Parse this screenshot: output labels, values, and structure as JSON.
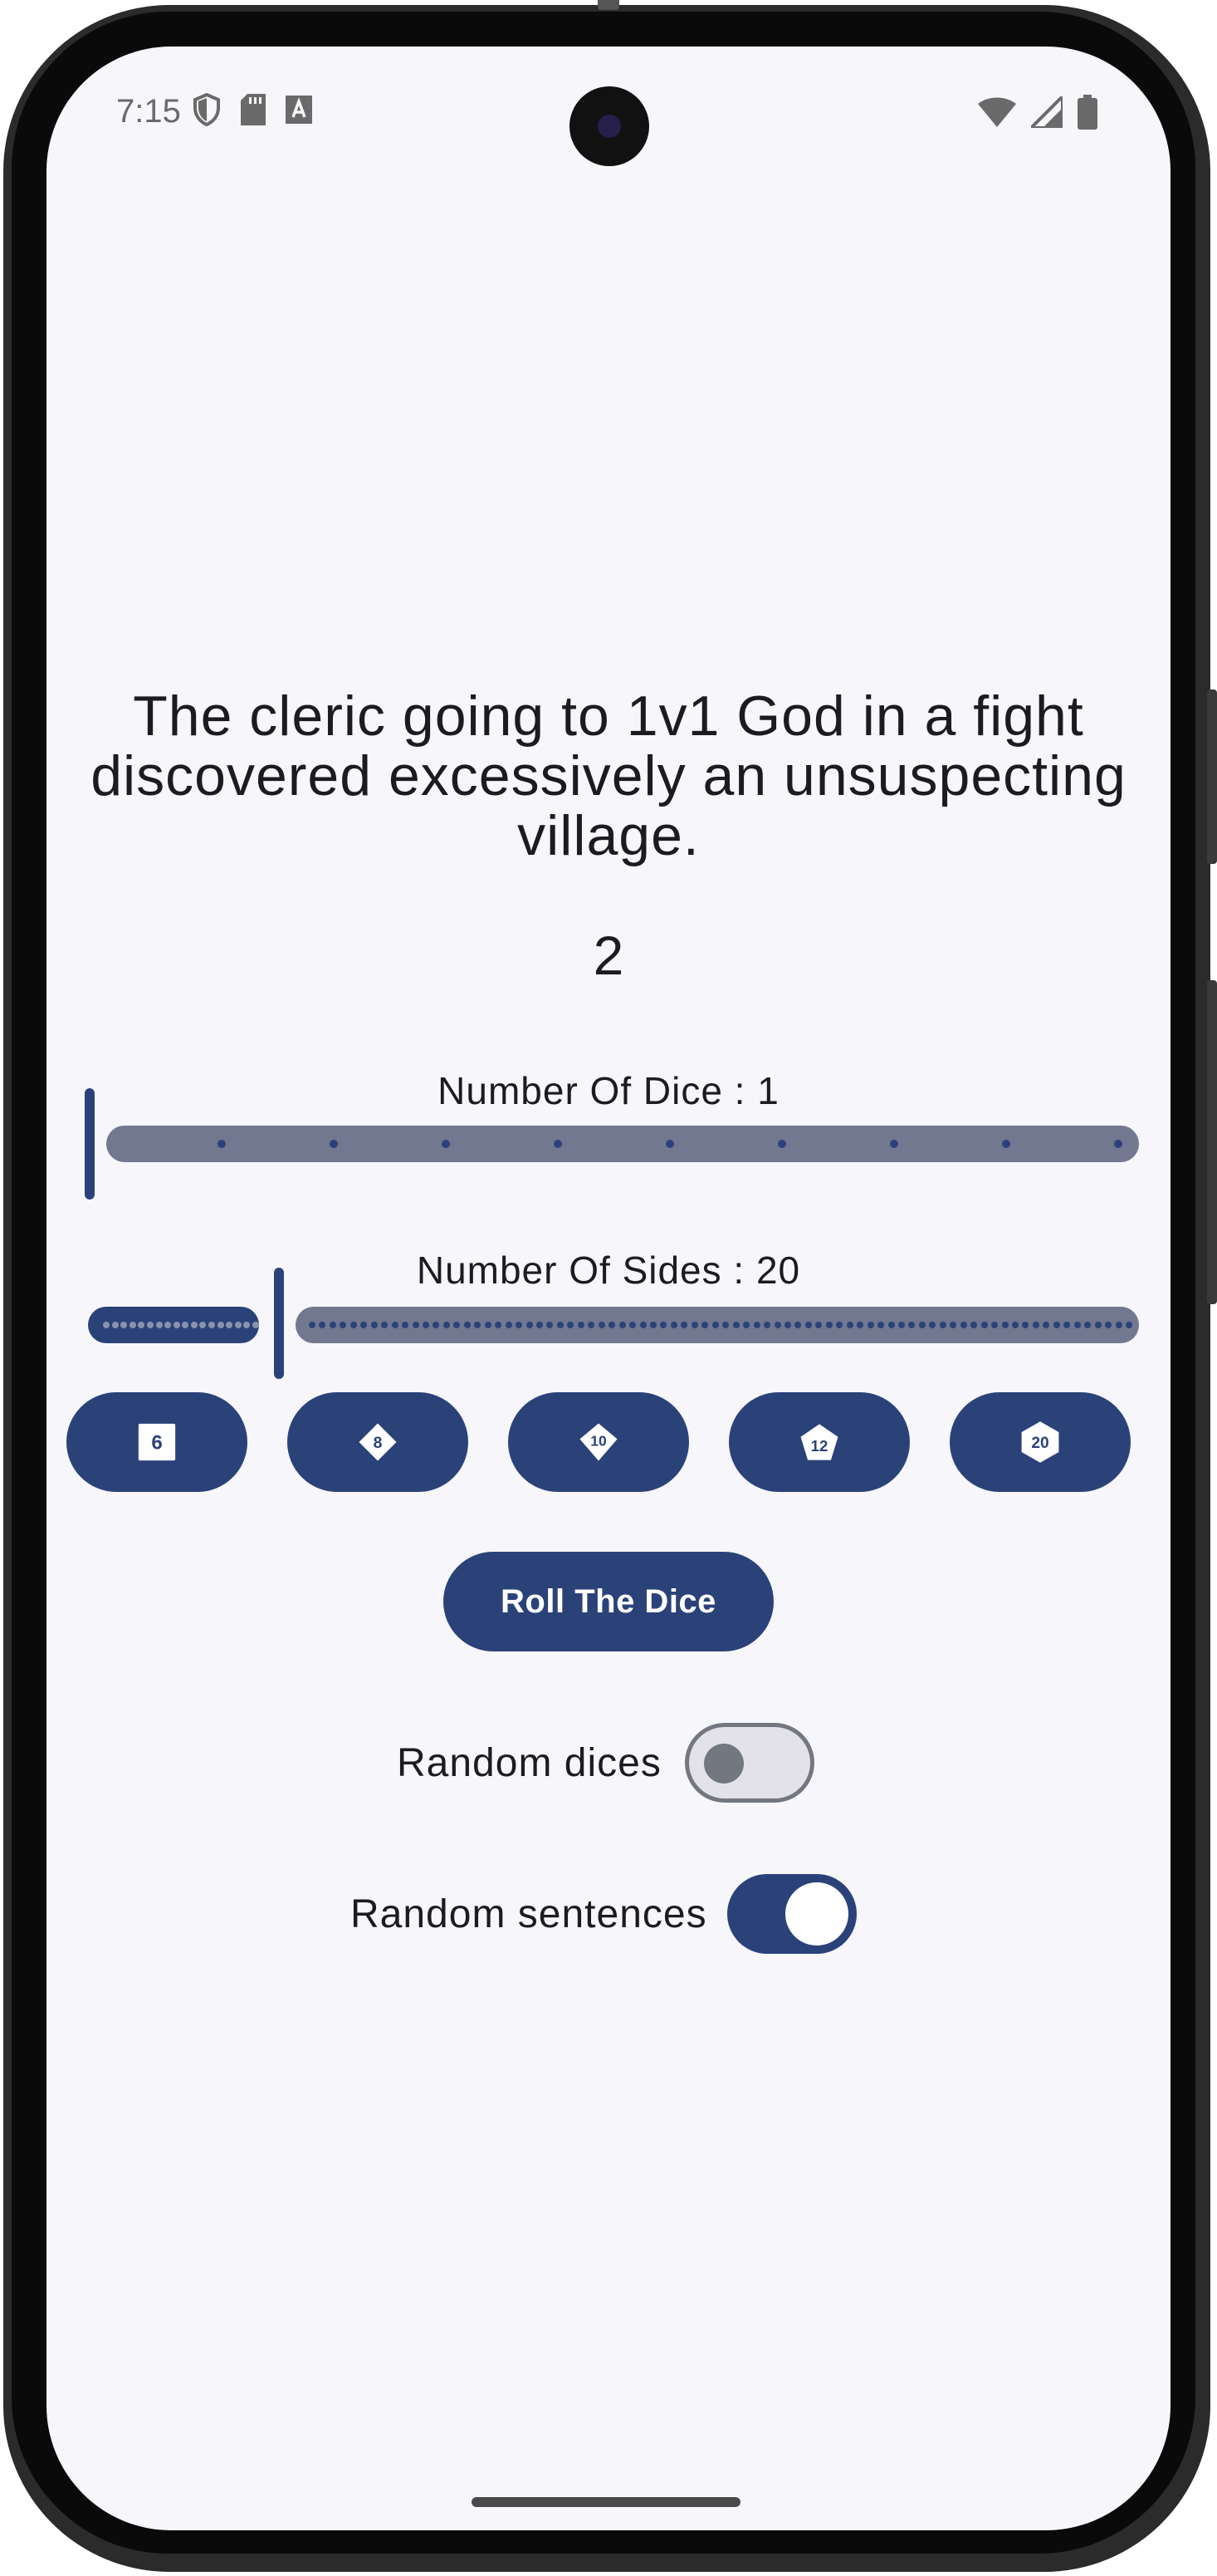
{
  "status_bar": {
    "time": "7:15",
    "left_icons": [
      "shield-icon",
      "sd-card-icon",
      "font-a-icon"
    ],
    "right_icons": [
      "wifi-icon",
      "cellular-signal-icon",
      "battery-icon"
    ]
  },
  "sentence": "The cleric going to 1v1 God in a fight discovered excessively an unsuspecting village.",
  "result": "2",
  "dice_count": {
    "label": "Number Of Dice : 1",
    "value": 1,
    "min": 1,
    "max": 10
  },
  "sides_count": {
    "label": "Number Of Sides : 20",
    "value": 20,
    "min": 2,
    "max": 100
  },
  "dice_presets": [
    {
      "label": "6",
      "icon": "d6-icon"
    },
    {
      "label": "8",
      "icon": "d8-icon"
    },
    {
      "label": "10",
      "icon": "d10-icon"
    },
    {
      "label": "12",
      "icon": "d12-icon"
    },
    {
      "label": "20",
      "icon": "d20-icon"
    }
  ],
  "roll_button": "Roll The Dice",
  "toggles": {
    "random_dices": {
      "label": "Random dices",
      "on": false
    },
    "random_sentences": {
      "label": "Random sentences",
      "on": true
    }
  },
  "colors": {
    "primary": "#2b4279",
    "background": "#f7f6fb",
    "track_inactive": "#71788f",
    "text": "#1c1b1f"
  }
}
